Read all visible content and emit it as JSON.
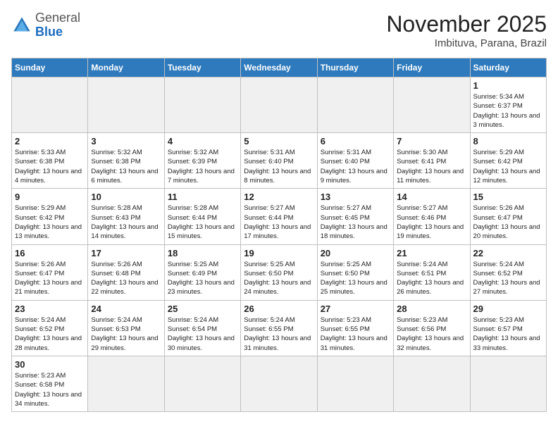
{
  "header": {
    "logo": {
      "general": "General",
      "blue": "Blue"
    },
    "title": "November 2025",
    "subtitle": "Imbituva, Parana, Brazil"
  },
  "weekdays": [
    "Sunday",
    "Monday",
    "Tuesday",
    "Wednesday",
    "Thursday",
    "Friday",
    "Saturday"
  ],
  "weeks": [
    [
      {
        "day": "",
        "info": "",
        "empty": true
      },
      {
        "day": "",
        "info": "",
        "empty": true
      },
      {
        "day": "",
        "info": "",
        "empty": true
      },
      {
        "day": "",
        "info": "",
        "empty": true
      },
      {
        "day": "",
        "info": "",
        "empty": true
      },
      {
        "day": "",
        "info": "",
        "empty": true
      },
      {
        "day": "1",
        "info": "Sunrise: 5:34 AM\nSunset: 6:37 PM\nDaylight: 13 hours and 3 minutes.",
        "empty": false
      }
    ],
    [
      {
        "day": "2",
        "info": "Sunrise: 5:33 AM\nSunset: 6:38 PM\nDaylight: 13 hours and 4 minutes.",
        "empty": false
      },
      {
        "day": "3",
        "info": "Sunrise: 5:32 AM\nSunset: 6:38 PM\nDaylight: 13 hours and 6 minutes.",
        "empty": false
      },
      {
        "day": "4",
        "info": "Sunrise: 5:32 AM\nSunset: 6:39 PM\nDaylight: 13 hours and 7 minutes.",
        "empty": false
      },
      {
        "day": "5",
        "info": "Sunrise: 5:31 AM\nSunset: 6:40 PM\nDaylight: 13 hours and 8 minutes.",
        "empty": false
      },
      {
        "day": "6",
        "info": "Sunrise: 5:31 AM\nSunset: 6:40 PM\nDaylight: 13 hours and 9 minutes.",
        "empty": false
      },
      {
        "day": "7",
        "info": "Sunrise: 5:30 AM\nSunset: 6:41 PM\nDaylight: 13 hours and 11 minutes.",
        "empty": false
      },
      {
        "day": "8",
        "info": "Sunrise: 5:29 AM\nSunset: 6:42 PM\nDaylight: 13 hours and 12 minutes.",
        "empty": false
      }
    ],
    [
      {
        "day": "9",
        "info": "Sunrise: 5:29 AM\nSunset: 6:42 PM\nDaylight: 13 hours and 13 minutes.",
        "empty": false
      },
      {
        "day": "10",
        "info": "Sunrise: 5:28 AM\nSunset: 6:43 PM\nDaylight: 13 hours and 14 minutes.",
        "empty": false
      },
      {
        "day": "11",
        "info": "Sunrise: 5:28 AM\nSunset: 6:44 PM\nDaylight: 13 hours and 15 minutes.",
        "empty": false
      },
      {
        "day": "12",
        "info": "Sunrise: 5:27 AM\nSunset: 6:44 PM\nDaylight: 13 hours and 17 minutes.",
        "empty": false
      },
      {
        "day": "13",
        "info": "Sunrise: 5:27 AM\nSunset: 6:45 PM\nDaylight: 13 hours and 18 minutes.",
        "empty": false
      },
      {
        "day": "14",
        "info": "Sunrise: 5:27 AM\nSunset: 6:46 PM\nDaylight: 13 hours and 19 minutes.",
        "empty": false
      },
      {
        "day": "15",
        "info": "Sunrise: 5:26 AM\nSunset: 6:47 PM\nDaylight: 13 hours and 20 minutes.",
        "empty": false
      }
    ],
    [
      {
        "day": "16",
        "info": "Sunrise: 5:26 AM\nSunset: 6:47 PM\nDaylight: 13 hours and 21 minutes.",
        "empty": false
      },
      {
        "day": "17",
        "info": "Sunrise: 5:26 AM\nSunset: 6:48 PM\nDaylight: 13 hours and 22 minutes.",
        "empty": false
      },
      {
        "day": "18",
        "info": "Sunrise: 5:25 AM\nSunset: 6:49 PM\nDaylight: 13 hours and 23 minutes.",
        "empty": false
      },
      {
        "day": "19",
        "info": "Sunrise: 5:25 AM\nSunset: 6:50 PM\nDaylight: 13 hours and 24 minutes.",
        "empty": false
      },
      {
        "day": "20",
        "info": "Sunrise: 5:25 AM\nSunset: 6:50 PM\nDaylight: 13 hours and 25 minutes.",
        "empty": false
      },
      {
        "day": "21",
        "info": "Sunrise: 5:24 AM\nSunset: 6:51 PM\nDaylight: 13 hours and 26 minutes.",
        "empty": false
      },
      {
        "day": "22",
        "info": "Sunrise: 5:24 AM\nSunset: 6:52 PM\nDaylight: 13 hours and 27 minutes.",
        "empty": false
      }
    ],
    [
      {
        "day": "23",
        "info": "Sunrise: 5:24 AM\nSunset: 6:52 PM\nDaylight: 13 hours and 28 minutes.",
        "empty": false
      },
      {
        "day": "24",
        "info": "Sunrise: 5:24 AM\nSunset: 6:53 PM\nDaylight: 13 hours and 29 minutes.",
        "empty": false
      },
      {
        "day": "25",
        "info": "Sunrise: 5:24 AM\nSunset: 6:54 PM\nDaylight: 13 hours and 30 minutes.",
        "empty": false
      },
      {
        "day": "26",
        "info": "Sunrise: 5:24 AM\nSunset: 6:55 PM\nDaylight: 13 hours and 31 minutes.",
        "empty": false
      },
      {
        "day": "27",
        "info": "Sunrise: 5:23 AM\nSunset: 6:55 PM\nDaylight: 13 hours and 31 minutes.",
        "empty": false
      },
      {
        "day": "28",
        "info": "Sunrise: 5:23 AM\nSunset: 6:56 PM\nDaylight: 13 hours and 32 minutes.",
        "empty": false
      },
      {
        "day": "29",
        "info": "Sunrise: 5:23 AM\nSunset: 6:57 PM\nDaylight: 13 hours and 33 minutes.",
        "empty": false
      }
    ],
    [
      {
        "day": "30",
        "info": "Sunrise: 5:23 AM\nSunset: 6:58 PM\nDaylight: 13 hours and 34 minutes.",
        "empty": false
      },
      {
        "day": "",
        "info": "",
        "empty": true
      },
      {
        "day": "",
        "info": "",
        "empty": true
      },
      {
        "day": "",
        "info": "",
        "empty": true
      },
      {
        "day": "",
        "info": "",
        "empty": true
      },
      {
        "day": "",
        "info": "",
        "empty": true
      },
      {
        "day": "",
        "info": "",
        "empty": true
      }
    ]
  ]
}
